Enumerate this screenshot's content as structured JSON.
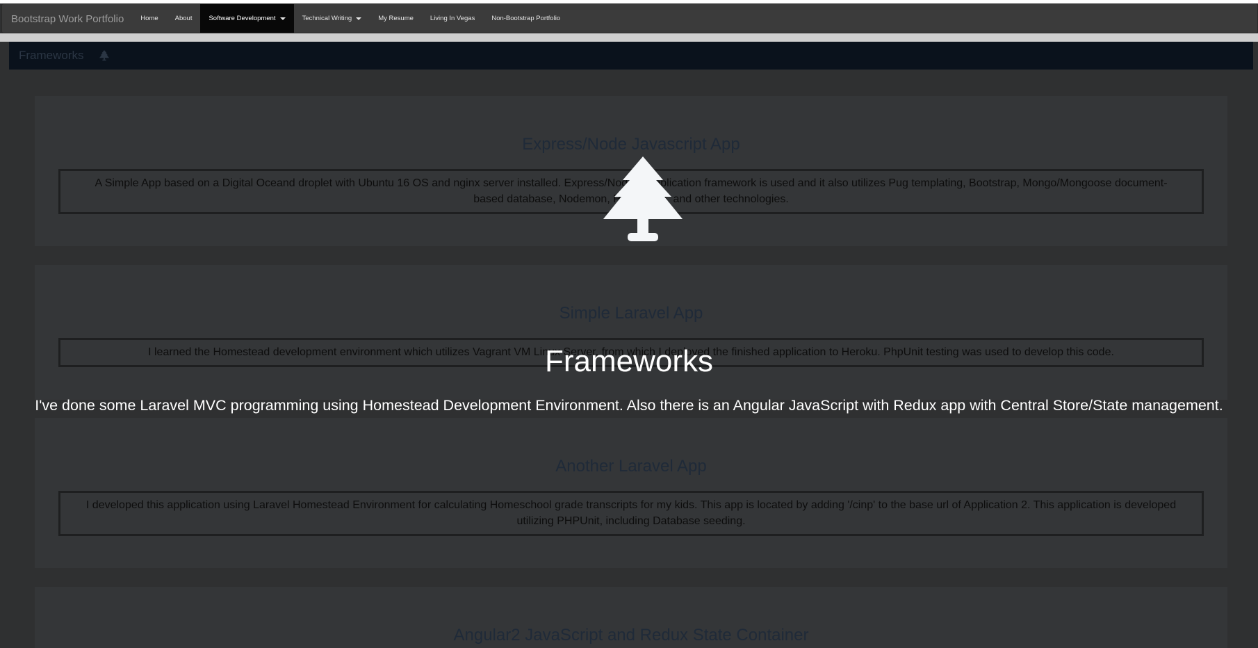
{
  "navbar": {
    "brand": "Bootstrap Work Portfolio",
    "items": [
      {
        "label": "Home"
      },
      {
        "label": "About"
      },
      {
        "label": "Software Development",
        "dropdown": true,
        "active": true
      },
      {
        "label": "Technical Writing",
        "dropdown": true
      },
      {
        "label": "My Resume"
      },
      {
        "label": "Living In Vegas"
      },
      {
        "label": "Non-Bootstrap Portfolio"
      }
    ]
  },
  "section": {
    "title": "Frameworks",
    "icon": "tree-icon"
  },
  "cards": [
    {
      "title": "Express/Node Javascript App",
      "text": "A Simple App based on a Digital Oceand droplet with Ubuntu 16 OS and nginx server installed. Express/Node.js application framework is used and it also utilizes Pug templating, Bootstrap, Mongo/Mongoose document-based database, Nodemon, Pm2, NPM, and other technologies."
    },
    {
      "title": "Simple Laravel App",
      "text": "I learned the Homestead development environment which utilizes Vagrant VM Linux Server, from which I deployed the finished application to Heroku. PhpUnit testing was used to develop this code."
    },
    {
      "title": "Another Laravel App",
      "text": "I developed this application using Laravel Homestead Environment for calculating Homeschool grade transcripts for my kids. This app is located by adding '/cinp' to the base url of Application 2. This application is developed utilizing PHPUnit, including Database seeding."
    },
    {
      "title": "Angular2 JavaScript and Redux State Container",
      "text": ""
    }
  ],
  "overlay": {
    "icon": "tree-icon",
    "title": "Frameworks",
    "subtitle": "I've done some Laravel MVC programming using Homestead Development Environment. Also there is an Angular JavaScript with Redux app with Central Store/State management."
  },
  "colors": {
    "navbar_bg": "#3b3b3b",
    "active_nav_bg": "#080808",
    "section_header_bg": "#0a121c",
    "page_bg": "#2f3031",
    "overlay_text": "#ffffff"
  }
}
